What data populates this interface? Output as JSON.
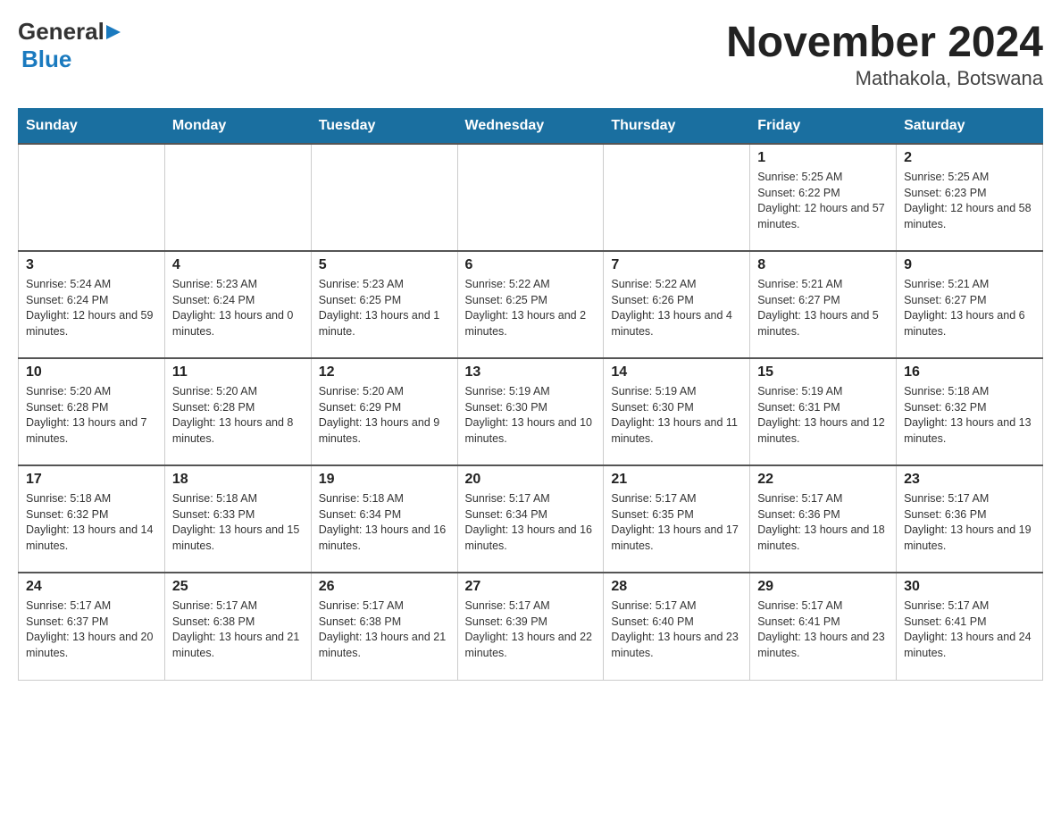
{
  "logo": {
    "text_general": "General",
    "text_blue": "Blue",
    "arrow": "▶"
  },
  "header": {
    "month_year": "November 2024",
    "location": "Mathakola, Botswana"
  },
  "days_of_week": [
    "Sunday",
    "Monday",
    "Tuesday",
    "Wednesday",
    "Thursday",
    "Friday",
    "Saturday"
  ],
  "weeks": [
    [
      {
        "day": "",
        "info": ""
      },
      {
        "day": "",
        "info": ""
      },
      {
        "day": "",
        "info": ""
      },
      {
        "day": "",
        "info": ""
      },
      {
        "day": "",
        "info": ""
      },
      {
        "day": "1",
        "info": "Sunrise: 5:25 AM\nSunset: 6:22 PM\nDaylight: 12 hours and 57 minutes."
      },
      {
        "day": "2",
        "info": "Sunrise: 5:25 AM\nSunset: 6:23 PM\nDaylight: 12 hours and 58 minutes."
      }
    ],
    [
      {
        "day": "3",
        "info": "Sunrise: 5:24 AM\nSunset: 6:24 PM\nDaylight: 12 hours and 59 minutes."
      },
      {
        "day": "4",
        "info": "Sunrise: 5:23 AM\nSunset: 6:24 PM\nDaylight: 13 hours and 0 minutes."
      },
      {
        "day": "5",
        "info": "Sunrise: 5:23 AM\nSunset: 6:25 PM\nDaylight: 13 hours and 1 minute."
      },
      {
        "day": "6",
        "info": "Sunrise: 5:22 AM\nSunset: 6:25 PM\nDaylight: 13 hours and 2 minutes."
      },
      {
        "day": "7",
        "info": "Sunrise: 5:22 AM\nSunset: 6:26 PM\nDaylight: 13 hours and 4 minutes."
      },
      {
        "day": "8",
        "info": "Sunrise: 5:21 AM\nSunset: 6:27 PM\nDaylight: 13 hours and 5 minutes."
      },
      {
        "day": "9",
        "info": "Sunrise: 5:21 AM\nSunset: 6:27 PM\nDaylight: 13 hours and 6 minutes."
      }
    ],
    [
      {
        "day": "10",
        "info": "Sunrise: 5:20 AM\nSunset: 6:28 PM\nDaylight: 13 hours and 7 minutes."
      },
      {
        "day": "11",
        "info": "Sunrise: 5:20 AM\nSunset: 6:28 PM\nDaylight: 13 hours and 8 minutes."
      },
      {
        "day": "12",
        "info": "Sunrise: 5:20 AM\nSunset: 6:29 PM\nDaylight: 13 hours and 9 minutes."
      },
      {
        "day": "13",
        "info": "Sunrise: 5:19 AM\nSunset: 6:30 PM\nDaylight: 13 hours and 10 minutes."
      },
      {
        "day": "14",
        "info": "Sunrise: 5:19 AM\nSunset: 6:30 PM\nDaylight: 13 hours and 11 minutes."
      },
      {
        "day": "15",
        "info": "Sunrise: 5:19 AM\nSunset: 6:31 PM\nDaylight: 13 hours and 12 minutes."
      },
      {
        "day": "16",
        "info": "Sunrise: 5:18 AM\nSunset: 6:32 PM\nDaylight: 13 hours and 13 minutes."
      }
    ],
    [
      {
        "day": "17",
        "info": "Sunrise: 5:18 AM\nSunset: 6:32 PM\nDaylight: 13 hours and 14 minutes."
      },
      {
        "day": "18",
        "info": "Sunrise: 5:18 AM\nSunset: 6:33 PM\nDaylight: 13 hours and 15 minutes."
      },
      {
        "day": "19",
        "info": "Sunrise: 5:18 AM\nSunset: 6:34 PM\nDaylight: 13 hours and 16 minutes."
      },
      {
        "day": "20",
        "info": "Sunrise: 5:17 AM\nSunset: 6:34 PM\nDaylight: 13 hours and 16 minutes."
      },
      {
        "day": "21",
        "info": "Sunrise: 5:17 AM\nSunset: 6:35 PM\nDaylight: 13 hours and 17 minutes."
      },
      {
        "day": "22",
        "info": "Sunrise: 5:17 AM\nSunset: 6:36 PM\nDaylight: 13 hours and 18 minutes."
      },
      {
        "day": "23",
        "info": "Sunrise: 5:17 AM\nSunset: 6:36 PM\nDaylight: 13 hours and 19 minutes."
      }
    ],
    [
      {
        "day": "24",
        "info": "Sunrise: 5:17 AM\nSunset: 6:37 PM\nDaylight: 13 hours and 20 minutes."
      },
      {
        "day": "25",
        "info": "Sunrise: 5:17 AM\nSunset: 6:38 PM\nDaylight: 13 hours and 21 minutes."
      },
      {
        "day": "26",
        "info": "Sunrise: 5:17 AM\nSunset: 6:38 PM\nDaylight: 13 hours and 21 minutes."
      },
      {
        "day": "27",
        "info": "Sunrise: 5:17 AM\nSunset: 6:39 PM\nDaylight: 13 hours and 22 minutes."
      },
      {
        "day": "28",
        "info": "Sunrise: 5:17 AM\nSunset: 6:40 PM\nDaylight: 13 hours and 23 minutes."
      },
      {
        "day": "29",
        "info": "Sunrise: 5:17 AM\nSunset: 6:41 PM\nDaylight: 13 hours and 23 minutes."
      },
      {
        "day": "30",
        "info": "Sunrise: 5:17 AM\nSunset: 6:41 PM\nDaylight: 13 hours and 24 minutes."
      }
    ]
  ]
}
